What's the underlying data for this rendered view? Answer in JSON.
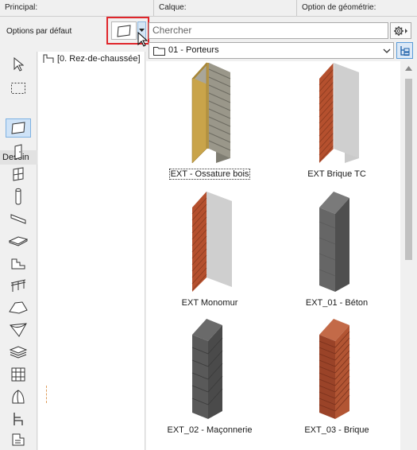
{
  "header": {
    "principal": "Principal:",
    "calque": "Calque:",
    "geometry_option": "Option de géométrie:"
  },
  "default_options_label": "Options par défaut",
  "search": {
    "placeholder": "Chercher"
  },
  "folder": {
    "selected": "01 - Porteurs"
  },
  "toolbox": {
    "section_label": "Dessin",
    "tools": [
      "arrow-tool",
      "marquee-tool",
      "wall-tool",
      "door-tool",
      "window-tool",
      "column-tool",
      "beam-tool",
      "slab-tool",
      "stair-tool",
      "railing-tool",
      "roof-tool",
      "shell-tool",
      "mesh-tool",
      "curtain-wall-tool",
      "morph-tool",
      "object-tool",
      "zone-tool"
    ]
  },
  "navigator": {
    "item": "[0. Rez-de-chaussée]"
  },
  "gallery": {
    "items": [
      {
        "label": "EXT - Ossature bois",
        "material": "wood",
        "selected": true
      },
      {
        "label": "EXT Brique TC",
        "material": "brick-plaster",
        "selected": false
      },
      {
        "label": "EXT Monomur",
        "material": "brick-plaster",
        "selected": false
      },
      {
        "label": "EXT_01 - Béton",
        "material": "concrete",
        "selected": false
      },
      {
        "label": "EXT_02 - Maçonnerie",
        "material": "masonry",
        "selected": false
      },
      {
        "label": "EXT_03 - Brique",
        "material": "brick",
        "selected": false
      }
    ]
  },
  "colors": {
    "highlight_border": "#e0262b",
    "selection_blue": "#cfe3f7",
    "brick": "#b5502e",
    "plaster": "#c9c9c9",
    "concrete": "#5d5d5d",
    "wood": "#8e8c7f"
  }
}
